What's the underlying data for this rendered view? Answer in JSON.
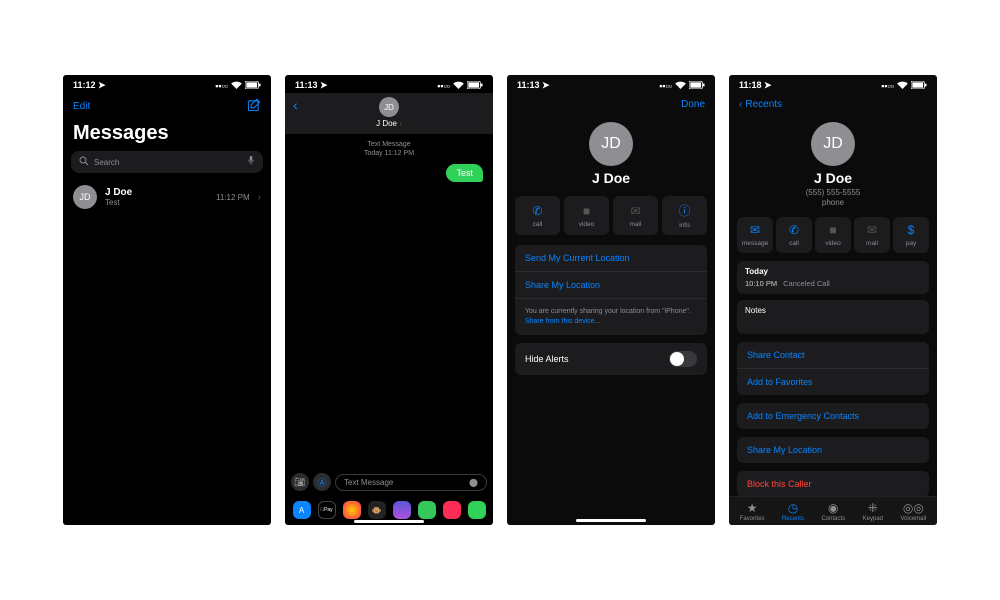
{
  "statusbar": {
    "times": [
      "11:12",
      "11:13",
      "11:13",
      "11:18"
    ],
    "loc_icon": "location-icon"
  },
  "s1": {
    "edit": "Edit",
    "title": "Messages",
    "search_placeholder": "Search",
    "thread": {
      "initials": "JD",
      "name": "J Doe",
      "preview": "Test",
      "time": "11:12 PM"
    }
  },
  "s2": {
    "initials": "JD",
    "name": "J Doe",
    "meta1": "Text Message",
    "meta2": "Today 11:12 PM",
    "bubble": "Test",
    "compose_placeholder": "Text Message",
    "app_labels": [
      "Store",
      "ApplePay",
      "Photos",
      "Animoji",
      "Music",
      "Digital",
      "More"
    ]
  },
  "s3": {
    "done": "Done",
    "initials": "JD",
    "name": "J Doe",
    "actions": [
      {
        "icon": "phone-icon",
        "label": "call",
        "enabled": true
      },
      {
        "icon": "video-icon",
        "label": "video",
        "enabled": false
      },
      {
        "icon": "mail-icon",
        "label": "mail",
        "enabled": false
      },
      {
        "icon": "info-icon",
        "label": "info",
        "enabled": true
      }
    ],
    "send_loc": "Send My Current Location",
    "share_loc": "Share My Location",
    "share_note": "You are currently sharing your location from \"iPhone\".",
    "share_link": "Share from this device...",
    "hide_alerts": "Hide Alerts",
    "hide_alerts_on": false
  },
  "s4": {
    "back": "Recents",
    "initials": "JD",
    "name": "J Doe",
    "phone": "(555) 555-5555",
    "phone_label": "phone",
    "actions": [
      {
        "icon": "message-icon",
        "label": "message",
        "enabled": true
      },
      {
        "icon": "phone-icon",
        "label": "call",
        "enabled": true
      },
      {
        "icon": "video-icon",
        "label": "video",
        "enabled": false
      },
      {
        "icon": "mail-icon",
        "label": "mail",
        "enabled": false
      },
      {
        "icon": "pay-icon",
        "label": "pay",
        "enabled": true
      }
    ],
    "log_header": "Today",
    "log_time": "10:10 PM",
    "log_status": "Canceled Call",
    "notes_label": "Notes",
    "share_contact": "Share Contact",
    "add_fav": "Add to Favorites",
    "add_emerg": "Add to Emergency Contacts",
    "share_loc": "Share My Location",
    "block": "Block this Caller",
    "tabs": [
      {
        "icon": "star-icon",
        "label": "Favorites"
      },
      {
        "icon": "clock-icon",
        "label": "Recents",
        "active": true
      },
      {
        "icon": "person-icon",
        "label": "Contacts"
      },
      {
        "icon": "keypad-icon",
        "label": "Keypad"
      },
      {
        "icon": "voicemail-icon",
        "label": "Voicemail"
      }
    ]
  }
}
